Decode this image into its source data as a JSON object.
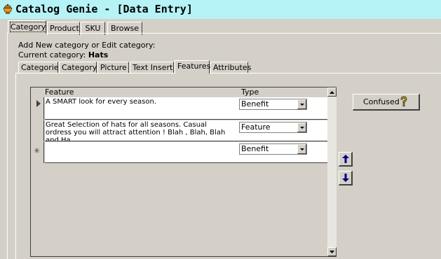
{
  "window": {
    "title": "Catalog Genie - [Data Entry]"
  },
  "main_tabs": [
    "Category",
    "Product",
    "SKU",
    "Browse"
  ],
  "header": {
    "line1": "Add New category or Edit category:",
    "current_label": "Current category:",
    "current_value": "Hats"
  },
  "sub_tabs": [
    "Categories",
    "Category",
    "Picture",
    "Text Insert",
    "Features",
    "Attributes"
  ],
  "grid": {
    "col_feature": "Feature",
    "col_type": "Type",
    "rows": [
      {
        "feature": "A SMART look for every season.",
        "type": "Benefit"
      },
      {
        "feature": "Great Selection of hats for all seasons.  Casual ordress you will attract attention !     Blah , Blah, Blah and Ha,",
        "type": "Feature"
      }
    ],
    "new_row_type": "Benefit",
    "new_row_marker": "✳"
  },
  "buttons": {
    "confused": "Confused"
  },
  "icons": {
    "app": "genie-lamp-icon",
    "help": "question-mark-icon",
    "up": "arrow-up-icon",
    "down": "arrow-down-icon"
  },
  "colors": {
    "titlebar": "#b6f3f7",
    "face": "#d4d0c8",
    "arrow": "#000080",
    "question": "#e8c000"
  }
}
